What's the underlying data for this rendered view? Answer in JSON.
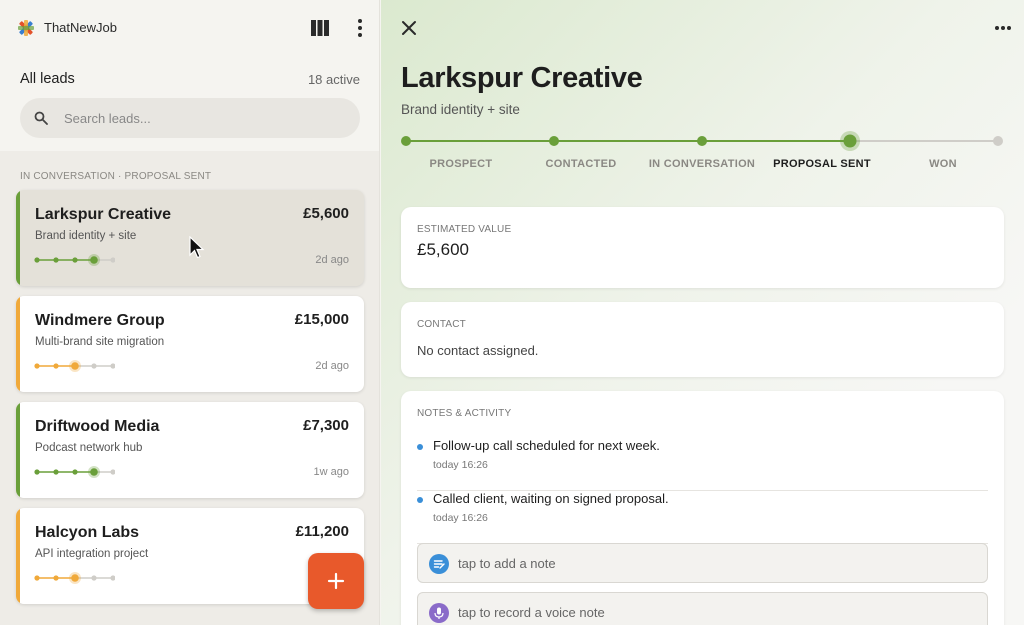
{
  "app": {
    "name": "ThatNewJob"
  },
  "sidebar": {
    "title": "All leads",
    "active_count": "18 active",
    "search_placeholder": "Search leads...",
    "group_label": "IN CONVERSATION · PROPOSAL SENT",
    "leads": [
      {
        "name": "Larkspur Creative",
        "value": "£5,600",
        "desc": "Brand identity + site",
        "ago": "2d ago",
        "stage": 3,
        "status_color": "#6a9f3a",
        "selected": true
      },
      {
        "name": "Windmere Group",
        "value": "£15,000",
        "desc": "Multi-brand site migration",
        "ago": "2d ago",
        "stage": 2,
        "status_color": "#f0a93a",
        "selected": false
      },
      {
        "name": "Driftwood Media",
        "value": "£7,300",
        "desc": "Podcast network hub",
        "ago": "1w ago",
        "stage": 3,
        "status_color": "#6a9f3a",
        "selected": false
      },
      {
        "name": "Halcyon Labs",
        "value": "£11,200",
        "desc": "API integration project",
        "ago": "",
        "stage": 2,
        "status_color": "#f0a93a",
        "selected": false
      }
    ]
  },
  "detail": {
    "title": "Larkspur Creative",
    "subtitle": "Brand identity + site",
    "stages": [
      "PROSPECT",
      "CONTACTED",
      "IN CONVERSATION",
      "PROPOSAL SENT",
      "WON"
    ],
    "current_stage": 3,
    "estimated_value_label": "ESTIMATED VALUE",
    "estimated_value": "£5,600",
    "contact_label": "CONTACT",
    "contact_text": "No contact assigned.",
    "notes_label": "NOTES & ACTIVITY",
    "notes": [
      {
        "text": "Follow-up call scheduled for next week.",
        "time": "today 16:26"
      },
      {
        "text": "Called client, waiting on signed proposal.",
        "time": "today 16:26"
      }
    ],
    "add_note_label": "tap to add a note",
    "voice_note_label": "tap to record a voice note"
  },
  "colors": {
    "accent_green": "#6a9f3a",
    "accent_orange": "#f0a93a",
    "fab": "#e8592b",
    "note_blue": "#3a8fd8",
    "voice_purple": "#8a6bc9"
  },
  "icons": [
    "logo-icon",
    "columns-icon",
    "kebab-icon",
    "search-icon",
    "plus-icon",
    "close-icon",
    "more-icon",
    "note-icon",
    "mic-icon",
    "cursor-icon"
  ]
}
